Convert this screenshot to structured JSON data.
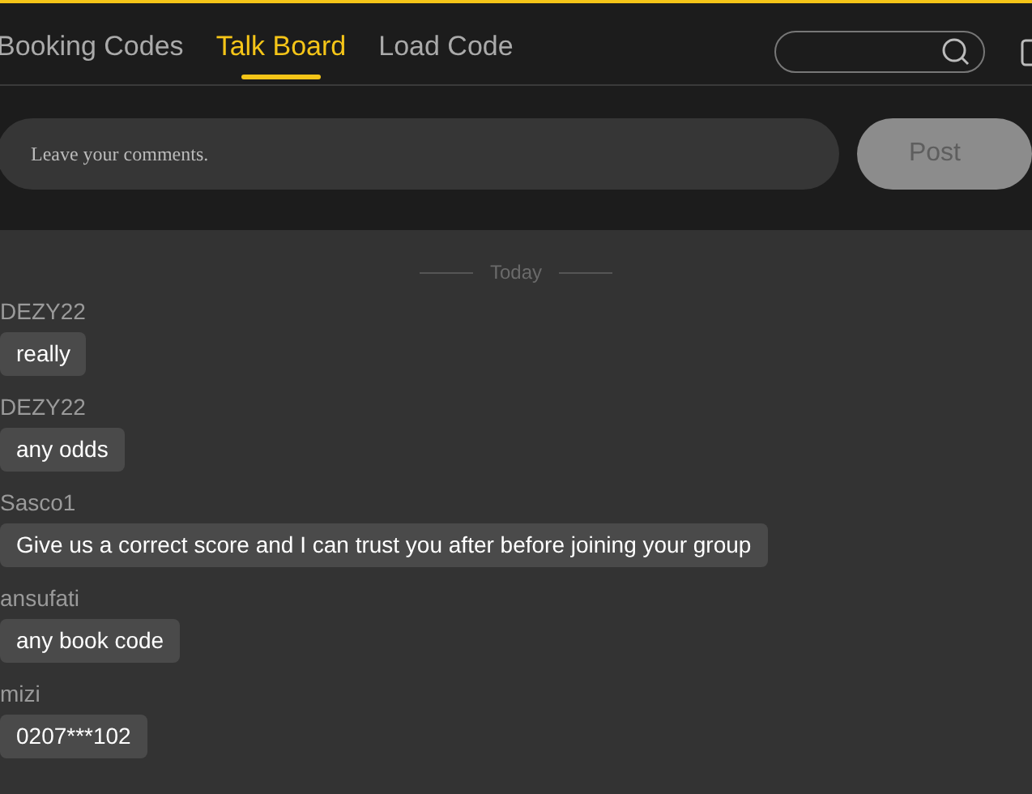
{
  "tabs": [
    {
      "label": "Booking Codes",
      "selected": false
    },
    {
      "label": "Talk Board",
      "selected": true
    },
    {
      "label": "Load Code",
      "selected": false
    }
  ],
  "comment": {
    "placeholder": "Leave your comments.",
    "button": "Post"
  },
  "divider": "Today",
  "messages": [
    {
      "user": "DEZY22",
      "text": "really"
    },
    {
      "user": "DEZY22",
      "text": "any odds"
    },
    {
      "user": "Sasco1",
      "text": "Give us a correct score and I can trust you after before joining your group"
    },
    {
      "user": "ansufati",
      "text": "any book code"
    },
    {
      "user": "mizi",
      "text": "0207***102"
    }
  ]
}
